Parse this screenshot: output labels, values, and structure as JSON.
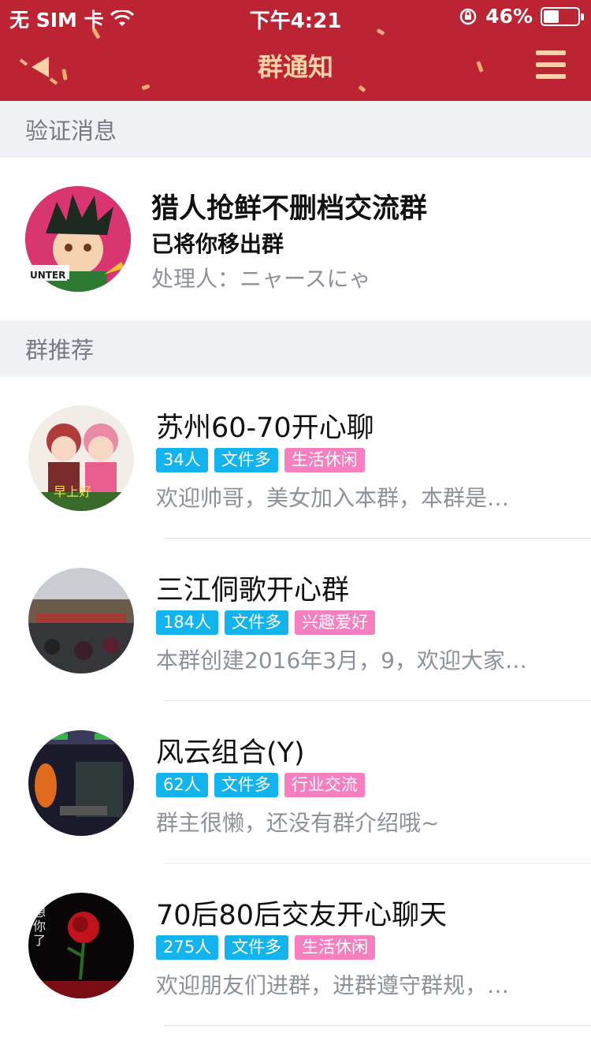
{
  "status_bar": {
    "carrier": "无 SIM 卡",
    "time": "下午4:21",
    "battery_percent": "46%",
    "battery_level": 0.46
  },
  "nav": {
    "title": "群通知",
    "back_icon": "back-arrow-icon",
    "menu_icon": "hamburger-menu-icon"
  },
  "verification": {
    "section_title": "验证消息",
    "group_name": "猎人抢鲜不删档交流群",
    "action": "已将你移出群",
    "handler": "处理人：ニャースにゃ",
    "avatar_text": "UNTER"
  },
  "recommend": {
    "section_title": "群推荐",
    "groups": [
      {
        "name": "苏州60-70开心聊",
        "tags": [
          {
            "text": "34人",
            "kind": "blue"
          },
          {
            "text": "文件多",
            "kind": "blue"
          },
          {
            "text": "生活休闲",
            "kind": "pink"
          }
        ],
        "desc": "欢迎帅哥，美女加入本群，本群是…",
        "avatar_text": "早上好"
      },
      {
        "name": "三江侗歌开心群",
        "tags": [
          {
            "text": "184人",
            "kind": "blue"
          },
          {
            "text": "文件多",
            "kind": "blue"
          },
          {
            "text": "兴趣爱好",
            "kind": "pink"
          }
        ],
        "desc": "本群创建2016年3月，9，欢迎大家…"
      },
      {
        "name": "风云组合(Y)",
        "tags": [
          {
            "text": "62人",
            "kind": "blue"
          },
          {
            "text": "文件多",
            "kind": "blue"
          },
          {
            "text": "行业交流",
            "kind": "pink"
          }
        ],
        "desc": "群主很懒，还没有群介绍哦~"
      },
      {
        "name": "70后80后交友开心聊天",
        "tags": [
          {
            "text": "275人",
            "kind": "blue"
          },
          {
            "text": "文件多",
            "kind": "blue"
          },
          {
            "text": "生活休闲",
            "kind": "pink"
          }
        ],
        "desc": "欢迎朋友们进群，进群遵守群规，…",
        "avatar_text": "想你了"
      }
    ]
  },
  "colors": {
    "header_bg": "#bd2433",
    "title_gold": "#f7d2a6",
    "tag_blue": "#13b4ee",
    "tag_pink": "#f67fbf",
    "section_bg": "#f0f1f5"
  }
}
